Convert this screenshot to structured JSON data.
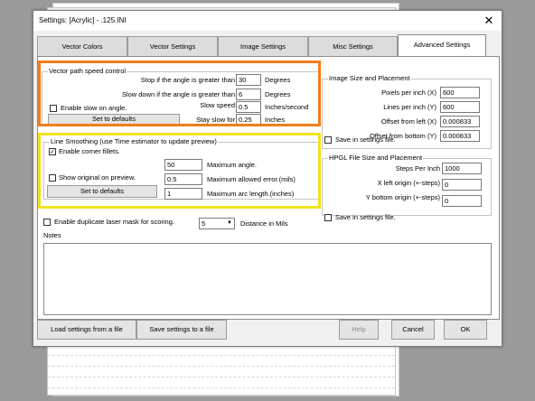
{
  "window": {
    "title": "Settings: [Acrylic] - .125.INI",
    "close_glyph": "✕"
  },
  "tabs": [
    {
      "label": "Vector Colors",
      "active": false
    },
    {
      "label": "Vector Settings",
      "active": false
    },
    {
      "label": "Image Settings",
      "active": false
    },
    {
      "label": "Misc Settings",
      "active": false
    },
    {
      "label": "Advanced Settings",
      "active": true
    }
  ],
  "vector_path": {
    "title": "Vector path speed control",
    "stop_label": "Stop if the angle is greater than",
    "stop_value": "30",
    "stop_unit": "Degrees",
    "slow_label": "Slow down if the angle is greater than",
    "slow_value": "6",
    "slow_unit": "Degrees",
    "enable_slow_label": "Enable slow on angle.",
    "enable_slow_checked": false,
    "slow_speed_label": "Slow speed",
    "slow_speed_value": "0.5",
    "slow_speed_unit": "Inches/second",
    "defaults_button": "Set to defaults",
    "stay_slow_label": "Stay slow for",
    "stay_slow_value": "0.25",
    "stay_slow_unit": "Inches"
  },
  "line_smoothing": {
    "title": "Line Smoothing (use Time estimator to update preview)",
    "enable_corner_label": "Enable corner fillets.",
    "enable_corner_checked": true,
    "max_angle_value": "50",
    "max_angle_label": "Maximum angle.",
    "show_original_label": "Show original on preview.",
    "show_original_checked": false,
    "max_error_value": "0.5",
    "max_error_label": "Maximum allowed error.(mils)",
    "defaults_button": "Set to defaults",
    "max_arc_value": "1",
    "max_arc_label": "Maximum arc length.(inches)"
  },
  "image_size": {
    "title": "Image Size and Placement",
    "ppi_x_label": "Pixels per inch (X)",
    "ppi_x_value": "600",
    "lpi_y_label": "Lines per inch (Y)",
    "lpi_y_value": "600",
    "offset_left_label": "Offset from left (X)",
    "offset_left_value": "0.000833",
    "offset_bottom_label": "Offset from bottom (Y)",
    "offset_bottom_value": "0.000833",
    "save_label": "Save in settings file.",
    "save_checked": false
  },
  "hpgl": {
    "title": "HPGL File Size and Placement",
    "steps_label": "Steps Per Inch",
    "steps_value": "1000",
    "x_origin_label": "X left origin (+-steps)",
    "x_origin_value": "0",
    "y_origin_label": "Y bottom origin (+-steps)",
    "y_origin_value": "0",
    "save_label": "Save in settings file.",
    "save_checked": false
  },
  "duplicate_mask": {
    "label": "Enable duplicate laser mask for scoring.",
    "checked": false,
    "distance_value": "5",
    "distance_label": "Distance in Mils"
  },
  "notes": {
    "label": "Notes",
    "value": ""
  },
  "footer": {
    "load_button": "Load settings from a file",
    "save_button": "Save settings to a file",
    "help_button": "Help",
    "cancel_button": "Cancel",
    "ok_button": "OK"
  },
  "colors": {
    "orange_highlight": "#f07d1e",
    "yellow_highlight": "#f2e21d",
    "background": "#9a9a9a"
  }
}
